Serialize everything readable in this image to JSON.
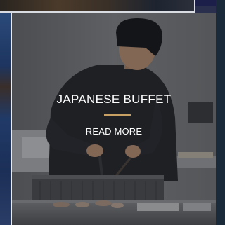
{
  "card": {
    "title": "JAPANESE BUFFET",
    "link_label": "READ MORE"
  },
  "colors": {
    "accent": "#c9a063",
    "title_text": "#ffffff",
    "frame": "#e7ebef"
  }
}
